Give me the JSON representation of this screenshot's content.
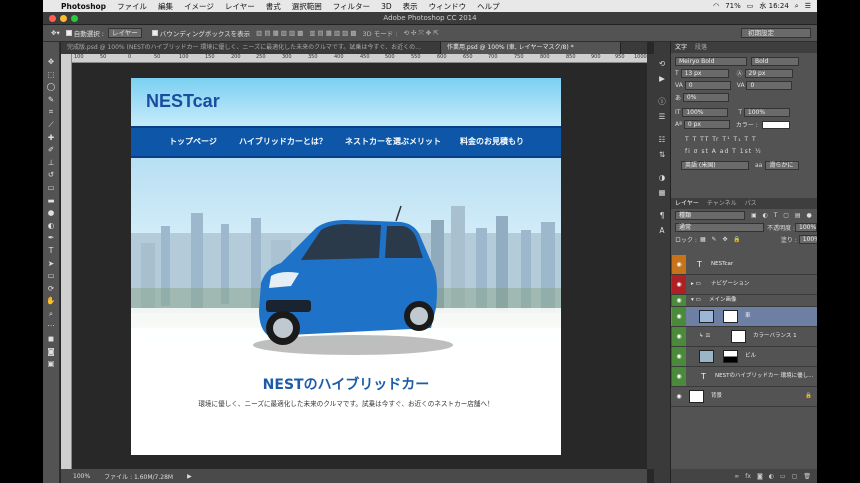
{
  "menubar": {
    "app": "Photoshop",
    "items": [
      "ファイル",
      "編集",
      "イメージ",
      "レイヤー",
      "書式",
      "選択範囲",
      "フィルター",
      "3D",
      "表示",
      "ウィンドウ",
      "ヘルプ"
    ],
    "battery": "71%",
    "time": "水 16:24"
  },
  "window": {
    "title": "Adobe Photoshop CC 2014"
  },
  "options": {
    "auto_select_label": "自動選択 :",
    "auto_select_value": "レイヤー",
    "bbox_label": "バウンディングボックスを表示",
    "mode3d": "3D モード :",
    "workspace": "初期設定"
  },
  "tabs": [
    {
      "label": "完成版.psd @ 100% (NESTのハイブリッドカー 環境に優しく、ニーズに最適化した未来のクルマです。試乗は今すぐ、お近くの…"
    },
    {
      "label": "作業用.psd @ 100% (車, レイヤーマスク/8) *"
    }
  ],
  "ruler": {
    "ticks": [
      "100",
      "50",
      "0",
      "50",
      "100",
      "150",
      "200",
      "250",
      "300",
      "350",
      "400",
      "450",
      "500",
      "550",
      "600",
      "650",
      "700",
      "750",
      "800",
      "850",
      "900",
      "950",
      "1000"
    ]
  },
  "status": {
    "zoom": "100%",
    "file": "ファイル : 1.60M/7.28M"
  },
  "site": {
    "logo": "NESTcar",
    "nav": [
      "トップページ",
      "ハイブリッドカーとは？",
      "ネストカーを選ぶメリット",
      "料金のお見積もり"
    ],
    "hero_title": "NESTのハイブリッドカー",
    "hero_sub": "環境に優しく、ニーズに最適化した未来のクルマです。試乗は今すぐ、お近くのネストカー店舗へ！"
  },
  "char_panel": {
    "tab1": "文字",
    "tab2": "段落",
    "font": "Meiryo Bold",
    "style": "Bold",
    "size": "13 px",
    "leading": "29 px",
    "kerning": "0",
    "tracking": "0",
    "vscale_pct": "0%",
    "hscale": "100%",
    "vscale": "100%",
    "baseline": "0 px",
    "color_label": "カラー :",
    "language": "英語 (米国)",
    "aa": "滑らかに"
  },
  "layers_panel": {
    "tabs": [
      "レイヤー",
      "チャンネル",
      "パス"
    ],
    "filter": "種類",
    "blend": "通常",
    "opacity_label": "不透明度 :",
    "opacity": "100%",
    "lock_label": "ロック :",
    "fill_label": "塗り :",
    "fill": "100%",
    "layers": [
      {
        "name": "NESTcar"
      },
      {
        "name": "ナビゲーション"
      },
      {
        "name": "メイン画像"
      },
      {
        "name": "車"
      },
      {
        "name": "カラーバランス 1"
      },
      {
        "name": "ビル"
      },
      {
        "name": "NESTのハイブリッドカー 環境に優し..."
      },
      {
        "name": "背景"
      }
    ]
  },
  "colors": {
    "accent": "#0d56a8",
    "brand": "#1b4d9e",
    "car": "#1e73c9"
  }
}
